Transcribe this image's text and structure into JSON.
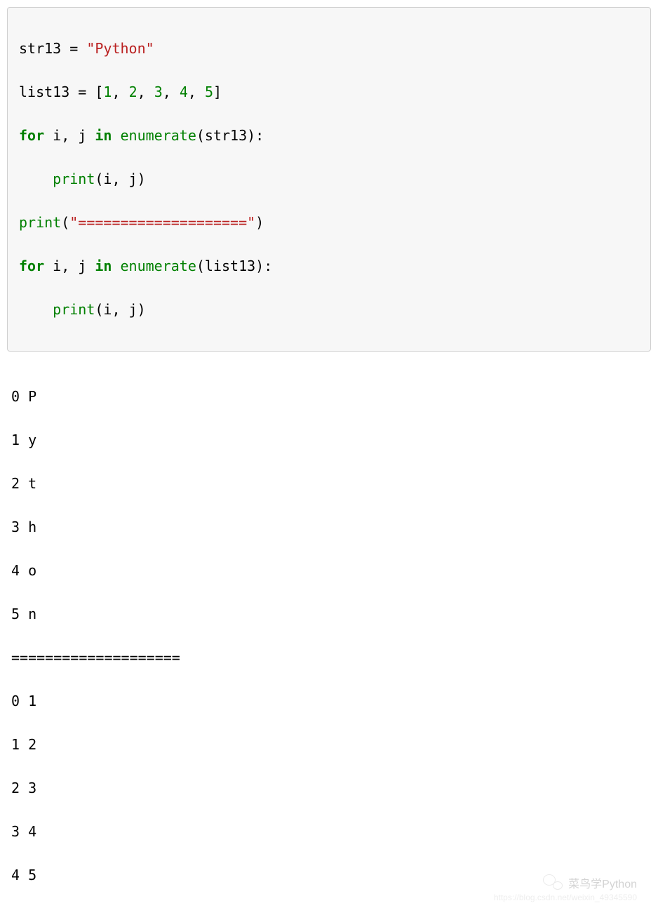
{
  "code": {
    "line1": {
      "a": "str13 = ",
      "str": "\"Python\""
    },
    "line2": {
      "a": "list13 = [",
      "n1": "1",
      "c1": ", ",
      "n2": "2",
      "c2": ", ",
      "n3": "3",
      "c3": ", ",
      "n4": "4",
      "c4": ", ",
      "n5": "5",
      "end": "]"
    },
    "line3": {
      "kw1": "for",
      "sp1": " i, j ",
      "kw2": "in",
      "sp2": " ",
      "bi": "enumerate",
      "rest": "(str13):"
    },
    "line4": {
      "indent": "    ",
      "bi": "print",
      "rest": "(i, j)"
    },
    "line5": {
      "bi": "print",
      "open": "(",
      "str": "\"====================\"",
      "close": ")"
    },
    "line6": {
      "kw1": "for",
      "sp1": " i, j ",
      "kw2": "in",
      "sp2": " ",
      "bi": "enumerate",
      "rest": "(list13):"
    },
    "line7": {
      "indent": "    ",
      "bi": "print",
      "rest": "(i, j)"
    }
  },
  "output": {
    "lines": [
      "0 P",
      "1 y",
      "2 t",
      "3 h",
      "4 o",
      "5 n",
      "====================",
      "0 1",
      "1 2",
      "2 3",
      "3 4",
      "4 5"
    ]
  },
  "watermark": {
    "title": "菜鸟学Python",
    "sub": "https://blog.csdn.net/weixin_49345590"
  }
}
